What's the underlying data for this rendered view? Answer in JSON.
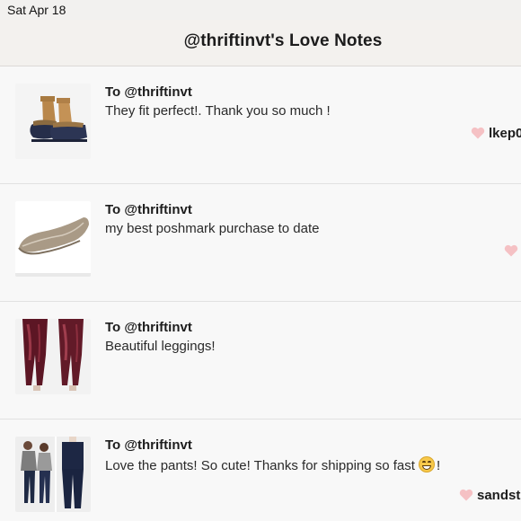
{
  "status_bar": {
    "date": "Sat Apr 18"
  },
  "header": {
    "title": "@thriftinvt's Love Notes"
  },
  "notes": [
    {
      "to": "To @thriftinvt",
      "message": "They fit perfect!. Thank you so much !",
      "author": "lkep0",
      "thumb_icon": "boots-icon"
    },
    {
      "to": "To @thriftinvt",
      "message": "my best poshmark purchase to date",
      "author": "",
      "thumb_icon": "flats-icon"
    },
    {
      "to": "To @thriftinvt",
      "message": "Beautiful leggings!",
      "author": "",
      "thumb_icon": "leggings-icon"
    },
    {
      "to": "To @thriftinvt",
      "message": "Love the pants! So cute! Thanks for shipping so fast",
      "message_end": "!",
      "emoji": "grinning-face-emoji",
      "author": "sandst",
      "thumb_icon": "pants-outfit-icon"
    }
  ],
  "colors": {
    "heart": "#f5c1c4",
    "divider": "#e1e1e1",
    "header_bg": "#f3f1ee"
  }
}
